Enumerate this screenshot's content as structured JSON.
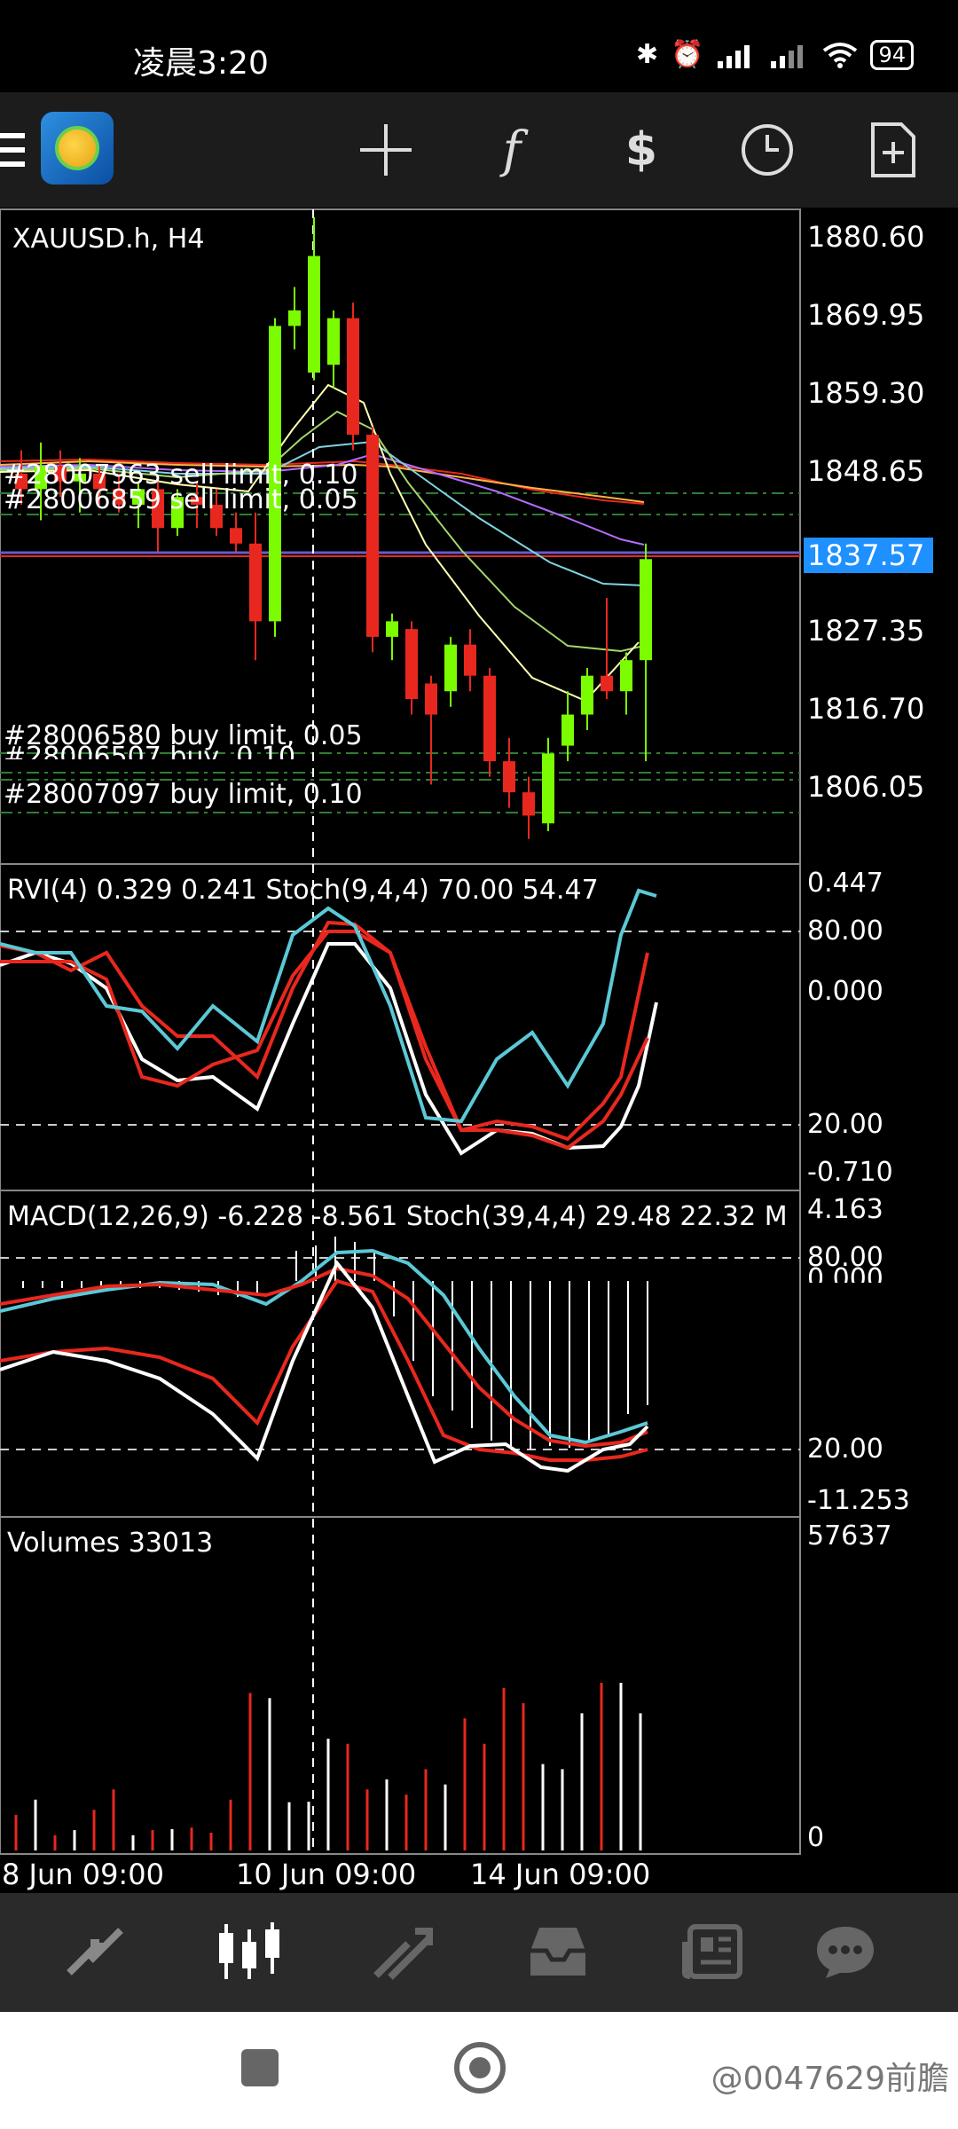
{
  "status_bar": {
    "time": "凌晨3:20",
    "battery": "94",
    "icons": [
      "bluetooth-icon",
      "alarm-icon",
      "signal-icon",
      "signal-icon",
      "wifi-icon",
      "battery-icon"
    ]
  },
  "toolbar": {
    "icons": [
      "menu-icon",
      "app-logo",
      "crosshair-icon",
      "function-icon",
      "trade-dollar-icon",
      "clock-icon",
      "new-document-icon"
    ]
  },
  "chart": {
    "symbol_label": "XAUUSD.h, H4",
    "price_ticks": [
      "1880.60",
      "1869.95",
      "1859.30",
      "1848.65",
      "1837.57",
      "1827.35",
      "1816.70",
      "1806.05"
    ],
    "current_price": "1837.57",
    "orders": [
      {
        "label": "#28007963 sell limit, 0.10"
      },
      {
        "label": "#28006859 sell limit, 0.05"
      },
      {
        "label": "#28006580 buy limit, 0.05"
      },
      {
        "label": "#28006507 buy, 0.10"
      },
      {
        "label": "#28007097 buy limit, 0.10"
      }
    ],
    "rvi_panel": {
      "label": "RVI(4) 0.329 0.241 Stoch(9,4,4) 70.00 54.47",
      "ticks": [
        "0.447",
        "80.00",
        "0.000",
        "20.00",
        "-0.710"
      ]
    },
    "macd_panel": {
      "label": "MACD(12,26,9) -6.228 -8.561 Stoch(39,4,4) 29.48 22.32 M",
      "ticks": [
        "4.163",
        "80.00",
        "0.000",
        "20.00",
        "-11.253"
      ]
    },
    "volume_panel": {
      "label": "Volumes 33013",
      "ticks": [
        "57637",
        "0"
      ]
    },
    "time_labels": [
      "8 Jun 09:00",
      "10 Jun 09:00",
      "14 Jun 09:00"
    ],
    "colors": {
      "bull": "#7CFC00",
      "bear": "#e8281e",
      "cyan": "#5bc8d6",
      "red_line": "#e8281e",
      "current_price_bg": "#1e90ff"
    }
  },
  "chart_data": {
    "type": "candlestick",
    "symbol": "XAUUSD.h",
    "timeframe": "H4",
    "ylim": [
      1800,
      1884
    ],
    "current_price": 1837.57,
    "candles": [
      {
        "o": 1850,
        "h": 1853,
        "l": 1846,
        "c": 1848
      },
      {
        "o": 1848,
        "h": 1854,
        "l": 1844,
        "c": 1851
      },
      {
        "o": 1851,
        "h": 1853,
        "l": 1847,
        "c": 1849
      },
      {
        "o": 1849,
        "h": 1852,
        "l": 1845,
        "c": 1850
      },
      {
        "o": 1850,
        "h": 1851,
        "l": 1846,
        "c": 1848
      },
      {
        "o": 1848,
        "h": 1850,
        "l": 1845,
        "c": 1846
      },
      {
        "o": 1846,
        "h": 1849,
        "l": 1843,
        "c": 1848
      },
      {
        "o": 1848,
        "h": 1849,
        "l": 1840,
        "c": 1843
      },
      {
        "o": 1843,
        "h": 1848,
        "l": 1842,
        "c": 1847
      },
      {
        "o": 1847,
        "h": 1849,
        "l": 1843,
        "c": 1846
      },
      {
        "o": 1846,
        "h": 1848,
        "l": 1842,
        "c": 1843
      },
      {
        "o": 1843,
        "h": 1845,
        "l": 1840,
        "c": 1841
      },
      {
        "o": 1841,
        "h": 1845,
        "l": 1826,
        "c": 1831
      },
      {
        "o": 1831,
        "h": 1870,
        "l": 1829,
        "c": 1869
      },
      {
        "o": 1869,
        "h": 1874,
        "l": 1866,
        "c": 1871
      },
      {
        "o": 1863,
        "h": 1883,
        "l": 1862,
        "c": 1878
      },
      {
        "o": 1864,
        "h": 1871,
        "l": 1861,
        "c": 1870
      },
      {
        "o": 1870,
        "h": 1872,
        "l": 1853,
        "c": 1855
      },
      {
        "o": 1855,
        "h": 1856,
        "l": 1827,
        "c": 1829
      },
      {
        "o": 1829,
        "h": 1832,
        "l": 1826,
        "c": 1831
      },
      {
        "o": 1830,
        "h": 1831,
        "l": 1819,
        "c": 1821
      },
      {
        "o": 1823,
        "h": 1824,
        "l": 1810,
        "c": 1819
      },
      {
        "o": 1822,
        "h": 1829,
        "l": 1820,
        "c": 1828
      },
      {
        "o": 1828,
        "h": 1830,
        "l": 1822,
        "c": 1824
      },
      {
        "o": 1824,
        "h": 1825,
        "l": 1811,
        "c": 1813
      },
      {
        "o": 1813,
        "h": 1816,
        "l": 1807,
        "c": 1809
      },
      {
        "o": 1809,
        "h": 1811,
        "l": 1803,
        "c": 1806
      },
      {
        "o": 1805,
        "h": 1816,
        "l": 1804,
        "c": 1814
      },
      {
        "o": 1815,
        "h": 1822,
        "l": 1813,
        "c": 1819
      },
      {
        "o": 1819,
        "h": 1825,
        "l": 1817,
        "c": 1824
      },
      {
        "o": 1824,
        "h": 1834,
        "l": 1821,
        "c": 1822
      },
      {
        "o": 1822,
        "h": 1827,
        "l": 1819,
        "c": 1826
      },
      {
        "o": 1826,
        "h": 1841,
        "l": 1813,
        "c": 1839
      }
    ],
    "volumes": [
      7000,
      10000,
      3000,
      4000,
      8000,
      12000,
      3000,
      4000,
      4200,
      4500,
      3500,
      10000,
      31000,
      30000,
      9500,
      9600,
      22000,
      21000,
      12000,
      14000,
      11000,
      16000,
      13000,
      26000,
      21000,
      32000,
      29000,
      17000,
      16000,
      27000,
      33000,
      33000,
      27000
    ]
  },
  "bottom_nav": {
    "icons": [
      "quotes-icon",
      "chart-icon",
      "trade-icon",
      "history-icon",
      "news-icon",
      "chat-icon"
    ]
  },
  "system_nav": {
    "watermark": "@0047629前膽"
  }
}
